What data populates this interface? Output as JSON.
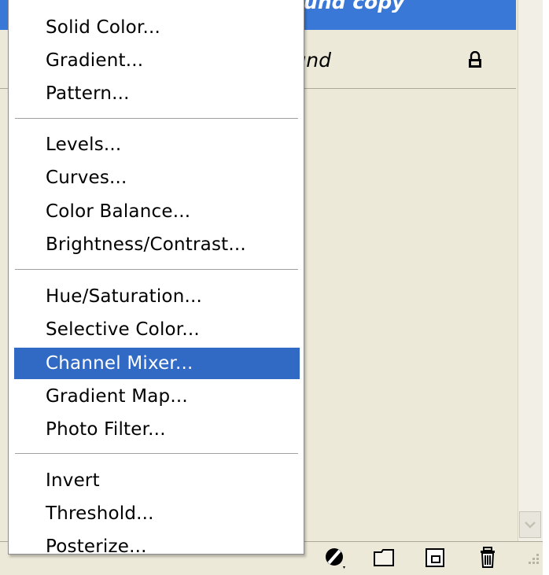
{
  "layers_panel": {
    "selected_layer_name": "kground copy",
    "background_layer_name": "ground",
    "lock_icon": "lock-icon",
    "colors": {
      "panel_bg": "#ece9d8",
      "selection": "#3a78d8"
    },
    "toolbar_icons": [
      "adjustment-layer-icon",
      "folder-icon",
      "new-layer-icon",
      "trash-icon"
    ]
  },
  "menu": {
    "groups": [
      [
        "Solid Color...",
        "Gradient...",
        "Pattern..."
      ],
      [
        "Levels...",
        "Curves...",
        "Color Balance...",
        "Brightness/Contrast..."
      ],
      [
        "Hue/Saturation...",
        "Selective Color...",
        "Channel Mixer...",
        "Gradient Map...",
        "Photo Filter..."
      ],
      [
        "Invert",
        "Threshold...",
        "Posterize..."
      ]
    ],
    "highlighted": "Channel Mixer...",
    "colors": {
      "highlight_bg": "#316ac5",
      "highlight_text": "#ffffff"
    }
  }
}
